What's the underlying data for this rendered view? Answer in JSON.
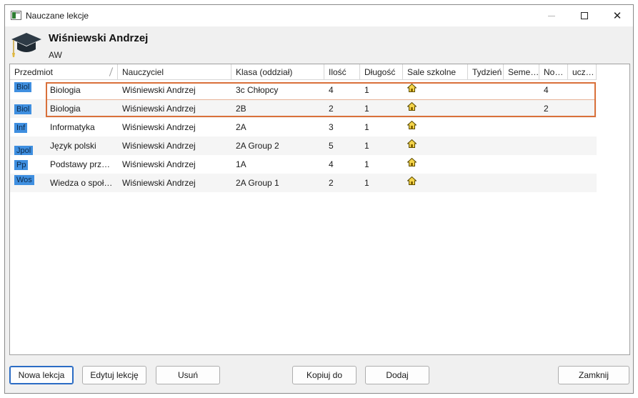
{
  "window": {
    "title": "Nauczane lekcje",
    "min_icon": "minimize-icon",
    "max_icon": "maximize-icon",
    "close_label": "✕"
  },
  "header": {
    "teacher_name": "Wiśniewski Andrzej",
    "teacher_abbr": "AW",
    "icon": "graduation-cap-icon"
  },
  "table": {
    "columns": [
      "Przedmiot",
      "Nauczyciel",
      "Klasa (oddział)",
      "Ilość",
      "Długość",
      "Sale szkolne",
      "Tydzień",
      "Seme…",
      "No…",
      "ucz…"
    ],
    "rows": [
      {
        "badge": "Biol",
        "subject": "Biologia",
        "teacher": "Wiśniewski Andrzej",
        "class": "3c Chłopcy",
        "count": "4",
        "length": "1",
        "room_icon": "house-icon",
        "week": "",
        "semester": "",
        "no": "4",
        "ucz": ""
      },
      {
        "badge": "Biol",
        "subject": "Biologia",
        "teacher": "Wiśniewski Andrzej",
        "class": "2B",
        "count": "2",
        "length": "1",
        "room_icon": "house-icon",
        "week": "",
        "semester": "",
        "no": "2",
        "ucz": ""
      },
      {
        "badge": "Inf",
        "subject": "Informatyka",
        "teacher": "Wiśniewski Andrzej",
        "class": "2A",
        "count": "3",
        "length": "1",
        "room_icon": "house-icon",
        "week": "",
        "semester": "",
        "no": "",
        "ucz": ""
      },
      {
        "badge": "Jpol",
        "subject": "Język polski",
        "teacher": "Wiśniewski Andrzej",
        "class": "2A Group 2",
        "count": "5",
        "length": "1",
        "room_icon": "house-icon",
        "week": "",
        "semester": "",
        "no": "",
        "ucz": ""
      },
      {
        "badge": "Pp",
        "subject": "Podstawy prz…",
        "teacher": "Wiśniewski Andrzej",
        "class": "1A",
        "count": "4",
        "length": "1",
        "room_icon": "house-icon",
        "week": "",
        "semester": "",
        "no": "",
        "ucz": ""
      },
      {
        "badge": "Wos",
        "subject": "Wiedza o społ…",
        "teacher": "Wiśniewski Andrzej",
        "class": "2A Group 1",
        "count": "2",
        "length": "1",
        "room_icon": "house-icon",
        "week": "",
        "semester": "",
        "no": "",
        "ucz": ""
      }
    ]
  },
  "buttons": {
    "new_lesson": "Nowa lekcja",
    "edit_lesson": "Edytuj lekcję",
    "delete": "Usuń",
    "copy_to": "Kopiuj do",
    "add": "Dodaj",
    "close": "Zamknij"
  },
  "colors": {
    "highlight": "#d9703a",
    "badge": "#3f8fe0",
    "primary_border": "#2b6cc4"
  }
}
